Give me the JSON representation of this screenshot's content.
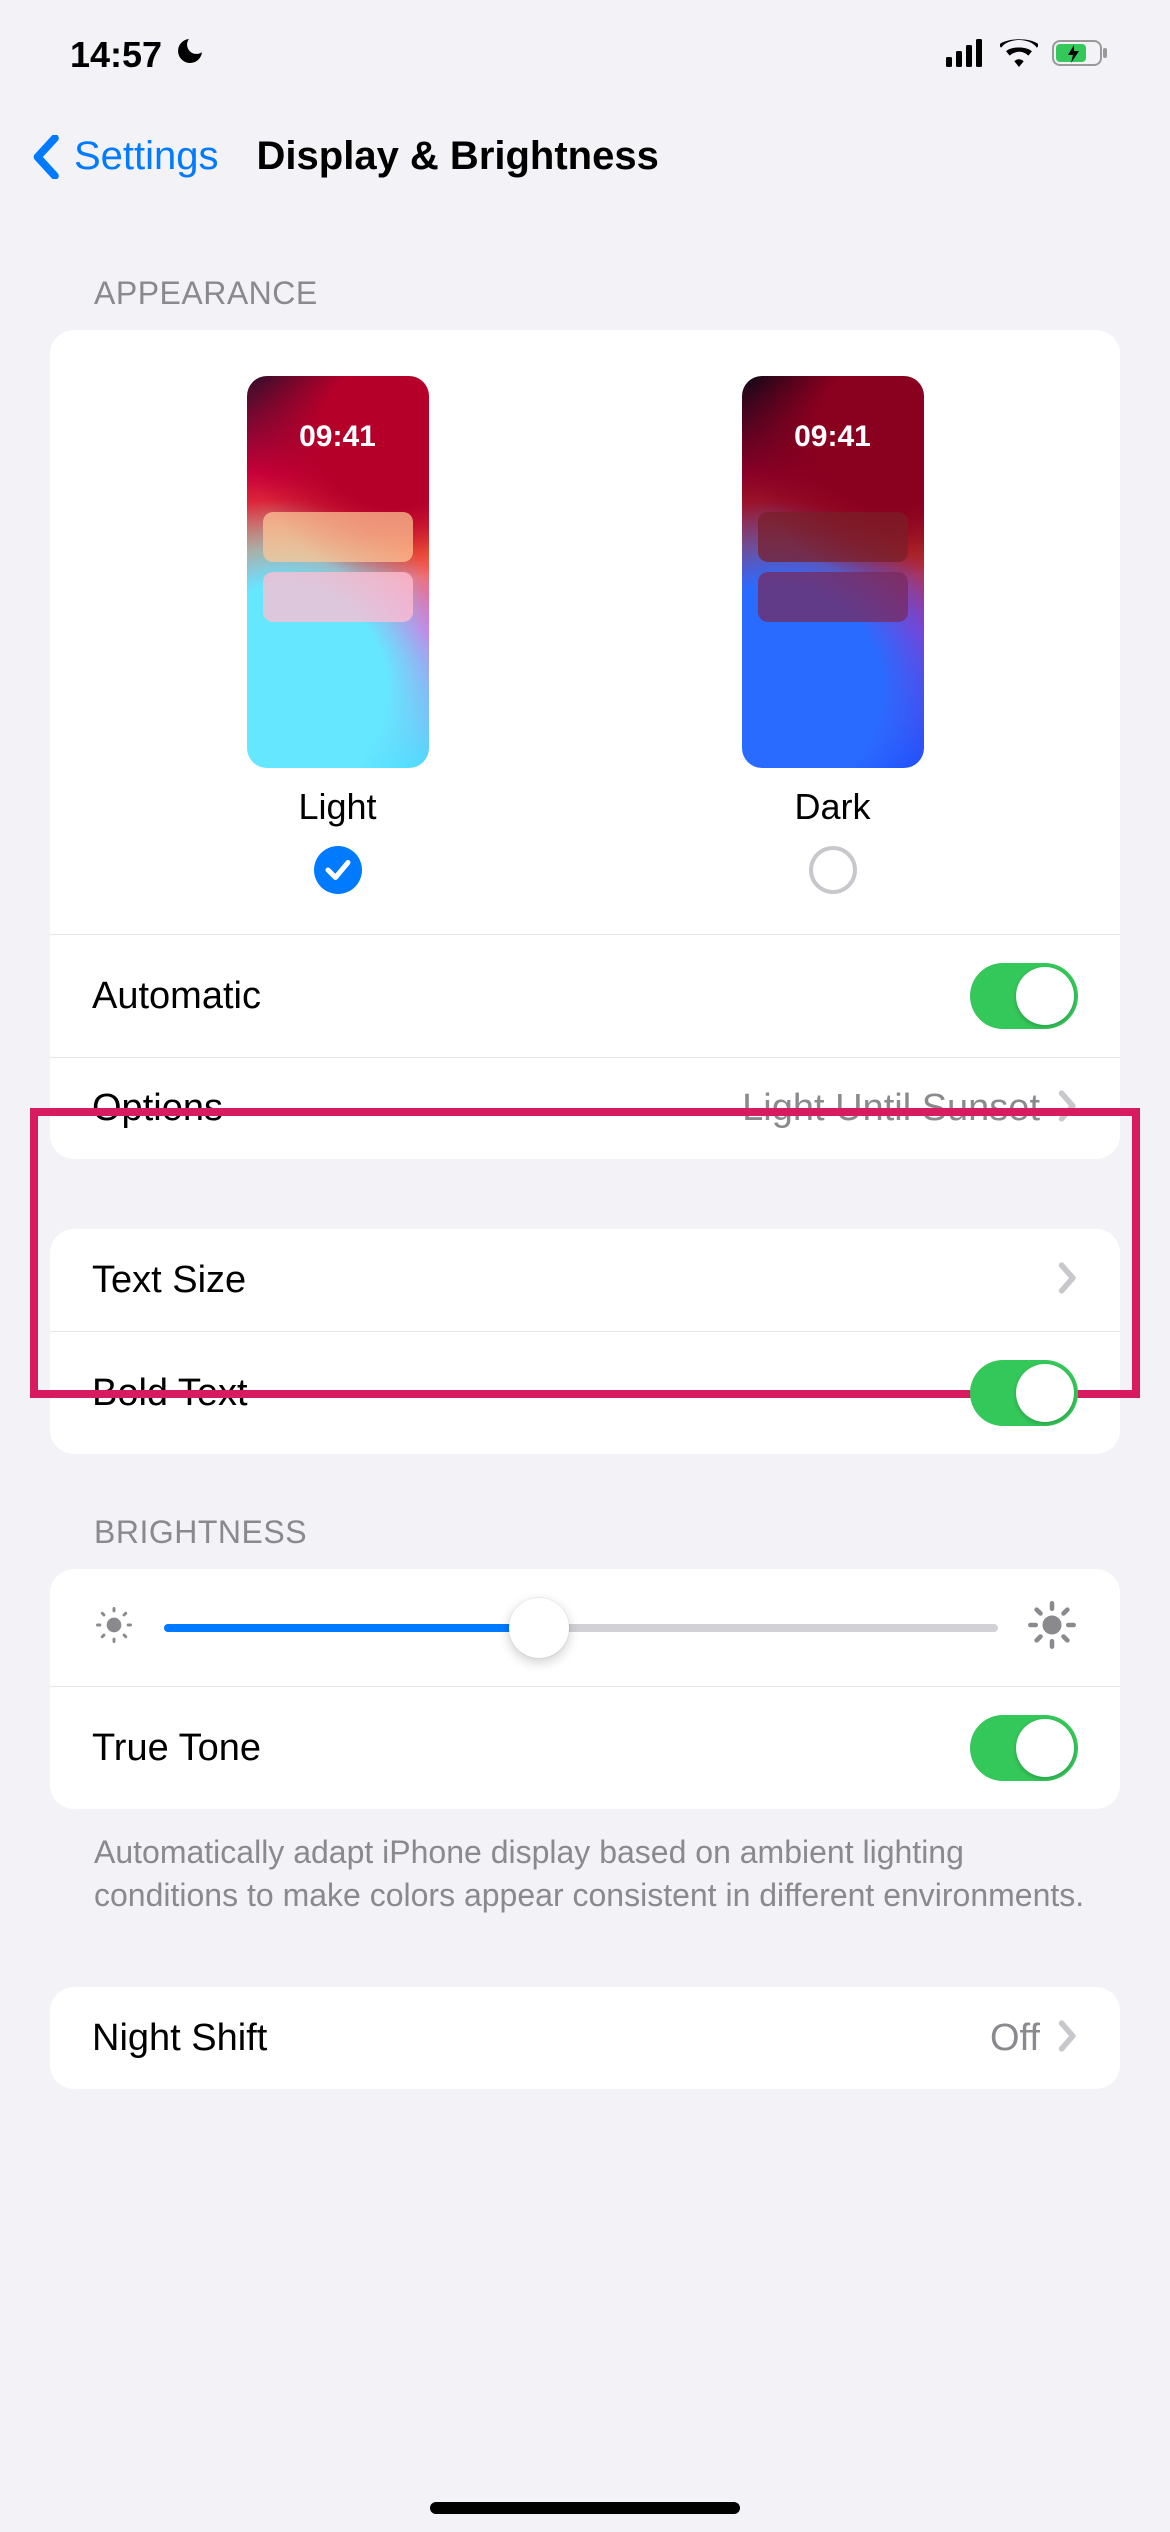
{
  "status": {
    "time": "14:57",
    "focus_icon": "moon",
    "battery_charging": true
  },
  "nav": {
    "back_label": "Settings",
    "title": "Display & Brightness"
  },
  "appearance": {
    "header": "APPEARANCE",
    "preview_time": "09:41",
    "light": {
      "label": "Light",
      "selected": true
    },
    "dark": {
      "label": "Dark",
      "selected": false
    },
    "automatic": {
      "label": "Automatic",
      "on": true
    },
    "options": {
      "label": "Options",
      "value": "Light Until Sunset"
    }
  },
  "text": {
    "text_size_label": "Text Size",
    "bold_text_label": "Bold Text",
    "bold_text_on": true
  },
  "brightness": {
    "header": "BRIGHTNESS",
    "value_percent": 45,
    "true_tone_label": "True Tone",
    "true_tone_on": true,
    "footer": "Automatically adapt iPhone display based on ambient lighting conditions to make colors appear consistent in different environments."
  },
  "night_shift": {
    "label": "Night Shift",
    "value": "Off"
  },
  "colors": {
    "accent": "#007aff",
    "toggle_on": "#34c759",
    "highlight_border": "#d81b60"
  }
}
